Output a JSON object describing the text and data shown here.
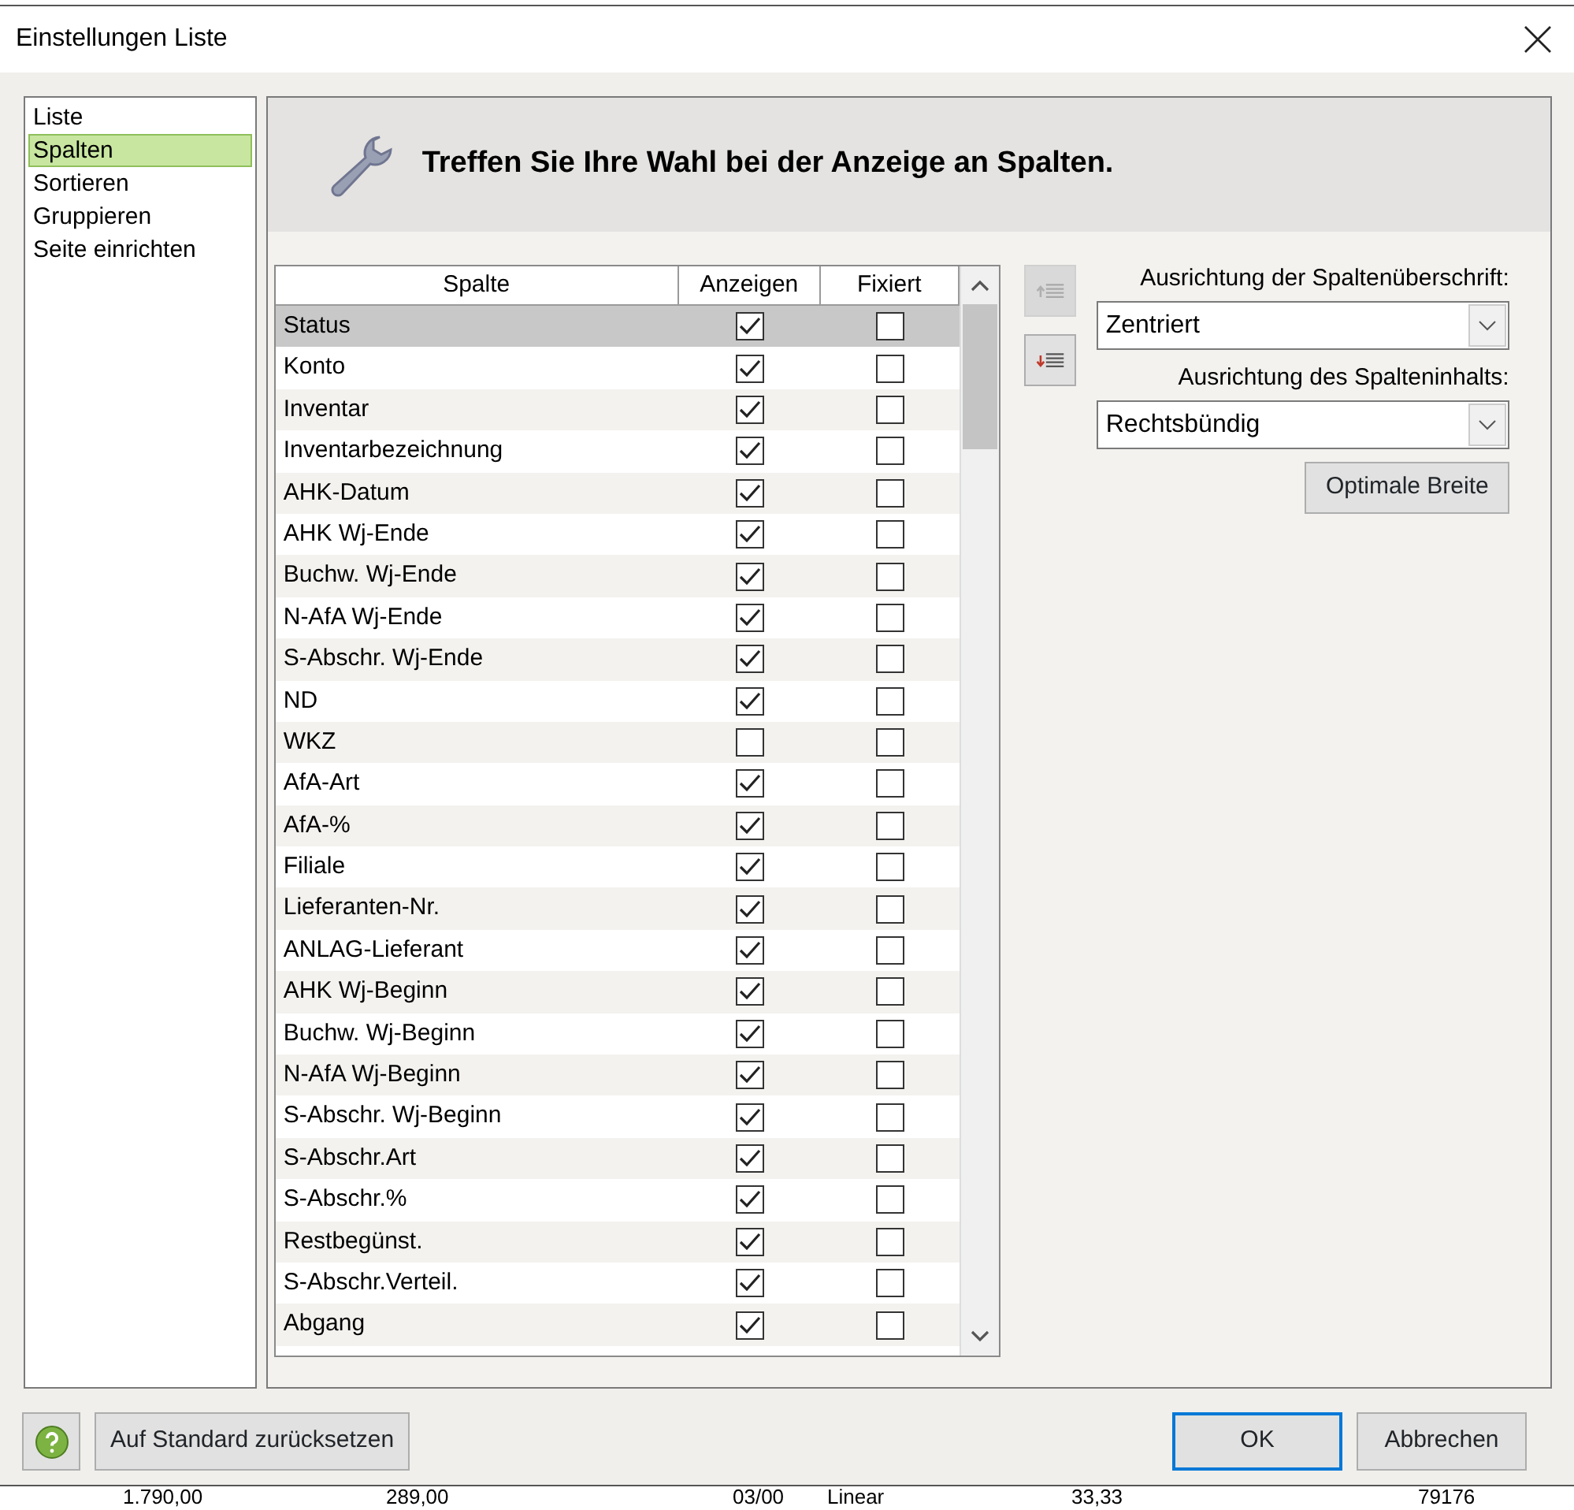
{
  "window": {
    "title": "Einstellungen Liste"
  },
  "sidebar": {
    "items": [
      {
        "label": "Liste",
        "selected": false
      },
      {
        "label": "Spalten",
        "selected": true
      },
      {
        "label": "Sortieren",
        "selected": false
      },
      {
        "label": "Gruppieren",
        "selected": false
      },
      {
        "label": "Seite einrichten",
        "selected": false
      }
    ]
  },
  "header": {
    "text": "Treffen Sie Ihre Wahl bei der Anzeige an Spalten."
  },
  "table": {
    "columns": [
      "Spalte",
      "Anzeigen",
      "Fixiert"
    ],
    "rows": [
      {
        "name": "Status",
        "show": true,
        "fixed": false,
        "selected": true
      },
      {
        "name": "Konto",
        "show": true,
        "fixed": false,
        "selected": false
      },
      {
        "name": "Inventar",
        "show": true,
        "fixed": false,
        "selected": false
      },
      {
        "name": "Inventarbezeichnung",
        "show": true,
        "fixed": false,
        "selected": false
      },
      {
        "name": "AHK-Datum",
        "show": true,
        "fixed": false,
        "selected": false
      },
      {
        "name": "AHK Wj-Ende",
        "show": true,
        "fixed": false,
        "selected": false
      },
      {
        "name": "Buchw. Wj-Ende",
        "show": true,
        "fixed": false,
        "selected": false
      },
      {
        "name": "N-AfA Wj-Ende",
        "show": true,
        "fixed": false,
        "selected": false
      },
      {
        "name": "S-Abschr. Wj-Ende",
        "show": true,
        "fixed": false,
        "selected": false
      },
      {
        "name": "ND",
        "show": true,
        "fixed": false,
        "selected": false
      },
      {
        "name": "WKZ",
        "show": false,
        "fixed": false,
        "selected": false
      },
      {
        "name": "AfA-Art",
        "show": true,
        "fixed": false,
        "selected": false
      },
      {
        "name": "AfA-%",
        "show": true,
        "fixed": false,
        "selected": false
      },
      {
        "name": "Filiale",
        "show": true,
        "fixed": false,
        "selected": false
      },
      {
        "name": "Lieferanten-Nr.",
        "show": true,
        "fixed": false,
        "selected": false
      },
      {
        "name": "ANLAG-Lieferant",
        "show": true,
        "fixed": false,
        "selected": false
      },
      {
        "name": "AHK Wj-Beginn",
        "show": true,
        "fixed": false,
        "selected": false
      },
      {
        "name": "Buchw. Wj-Beginn",
        "show": true,
        "fixed": false,
        "selected": false
      },
      {
        "name": "N-AfA Wj-Beginn",
        "show": true,
        "fixed": false,
        "selected": false
      },
      {
        "name": "S-Abschr. Wj-Beginn",
        "show": true,
        "fixed": false,
        "selected": false
      },
      {
        "name": "S-Abschr.Art",
        "show": true,
        "fixed": false,
        "selected": false
      },
      {
        "name": "S-Abschr.%",
        "show": true,
        "fixed": false,
        "selected": false
      },
      {
        "name": "Restbegünst.",
        "show": true,
        "fixed": false,
        "selected": false
      },
      {
        "name": "S-Abschr.Verteil.",
        "show": true,
        "fixed": false,
        "selected": false
      },
      {
        "name": "Abgang",
        "show": true,
        "fixed": false,
        "selected": false
      }
    ]
  },
  "move_buttons": [
    {
      "kind": "up",
      "disabled": true
    },
    {
      "kind": "down",
      "disabled": false
    }
  ],
  "header_alignment": {
    "label": "Ausrichtung der Spaltenüberschrift:",
    "value": "Zentriert"
  },
  "content_alignment": {
    "label": "Ausrichtung des Spalteninhalts:",
    "value": "Rechtsbündig"
  },
  "optimal_width_button": "Optimale Breite",
  "footer": {
    "reset_button": "Auf Standard zurücksetzen",
    "ok_button": "OK",
    "cancel_button": "Abbrechen"
  },
  "background_row": [
    "1.790,00",
    "289,00",
    "03/00",
    "Linear",
    "33,33",
    "79176"
  ]
}
